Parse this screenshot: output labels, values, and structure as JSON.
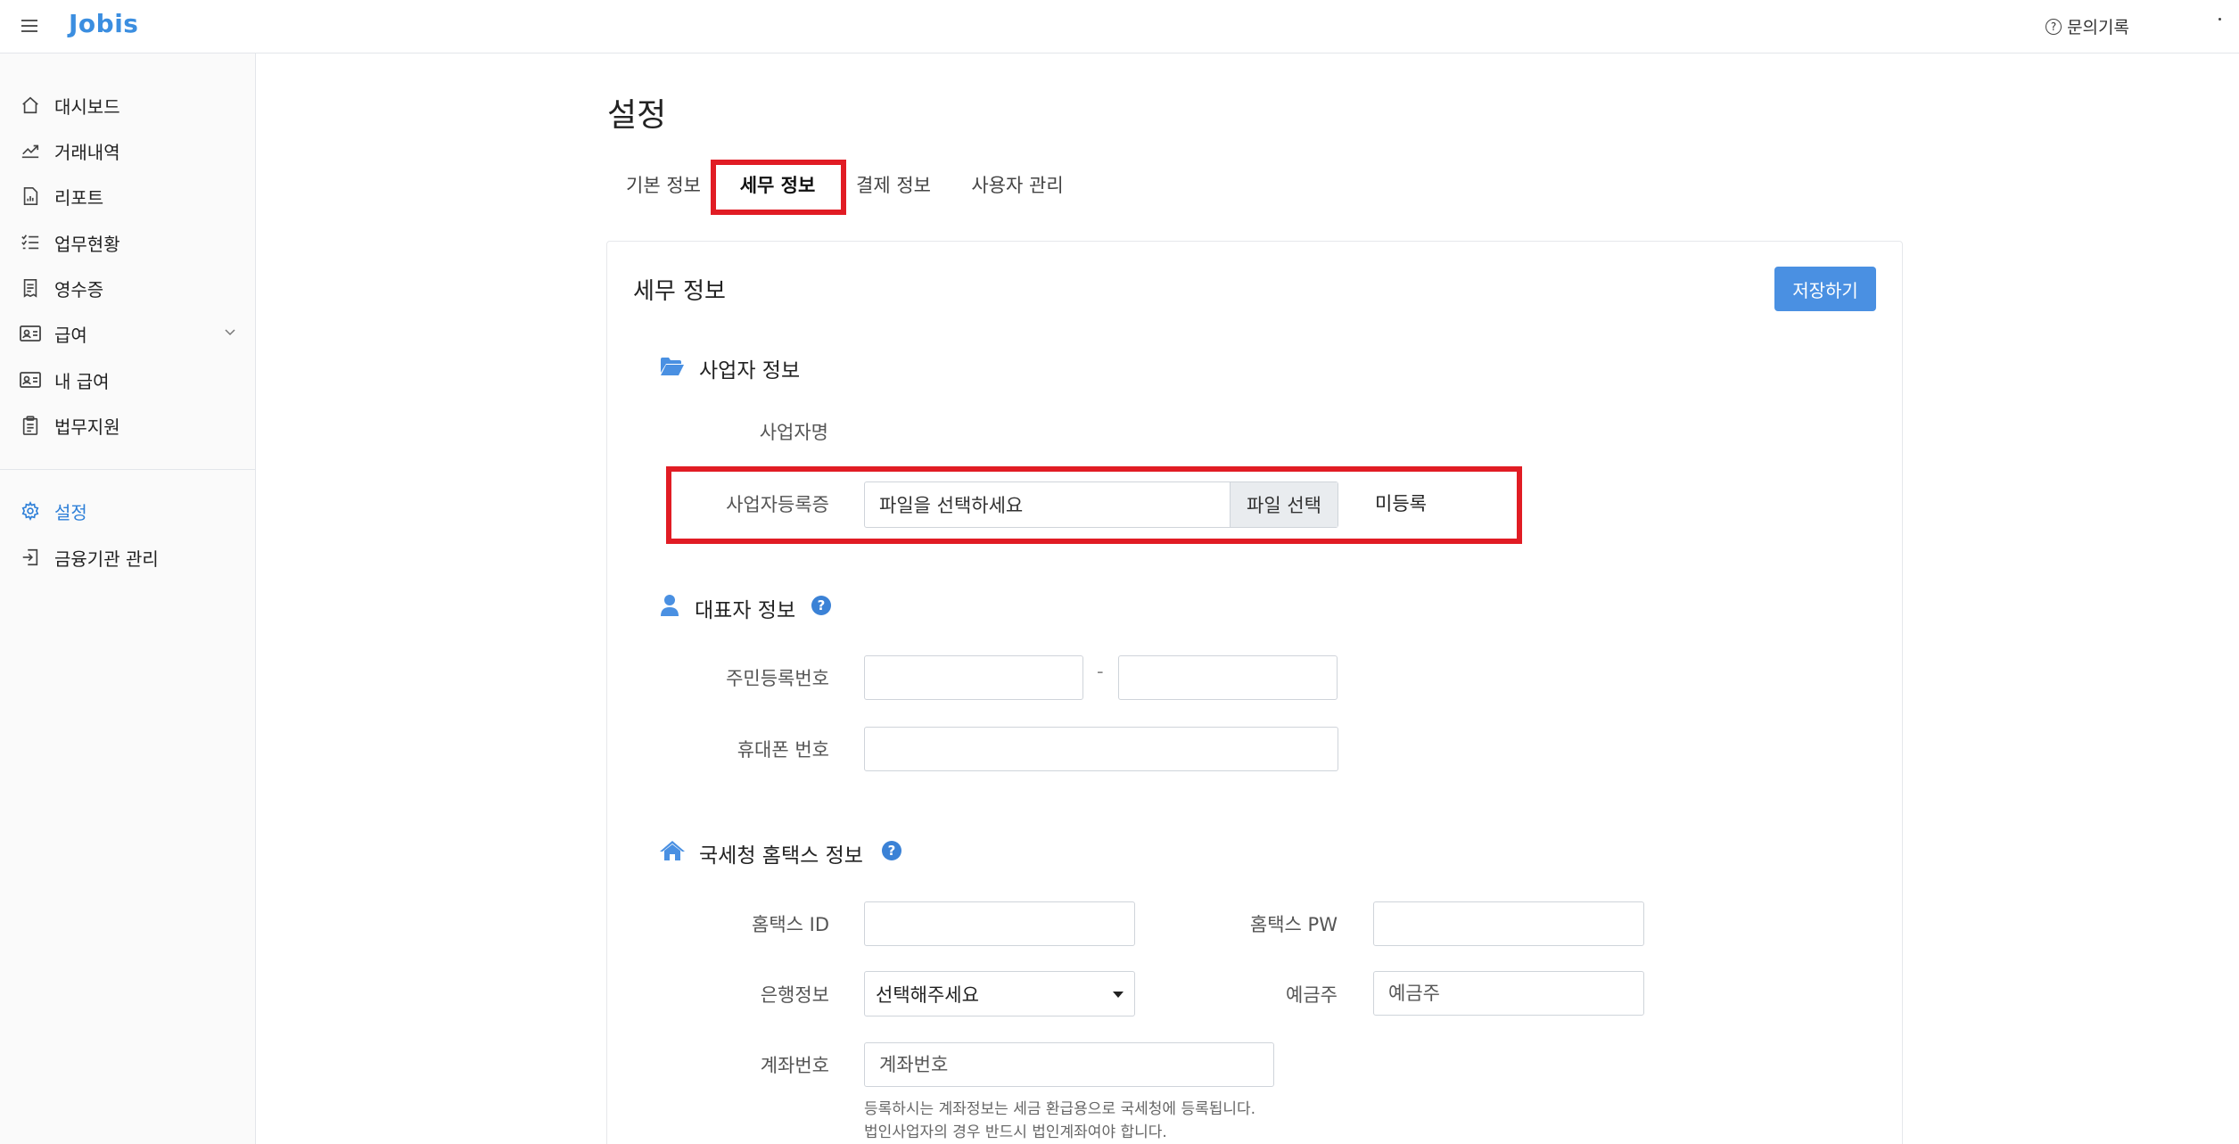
{
  "app": {
    "logo": "Jobis",
    "inquiry_label": "문의기록"
  },
  "sidebar": {
    "items": [
      {
        "label": "대시보드",
        "icon": "home-icon"
      },
      {
        "label": "거래내역",
        "icon": "chart-line-icon"
      },
      {
        "label": "리포트",
        "icon": "report-icon"
      },
      {
        "label": "업무현황",
        "icon": "checklist-icon"
      },
      {
        "label": "영수증",
        "icon": "receipt-icon"
      },
      {
        "label": "급여",
        "icon": "id-card-icon"
      },
      {
        "label": "내 급여",
        "icon": "id-card-icon"
      },
      {
        "label": "법무지원",
        "icon": "clipboard-icon"
      },
      {
        "label": "설정",
        "icon": "gear-icon"
      },
      {
        "label": "금융기관 관리",
        "icon": "sign-in-icon"
      }
    ],
    "active": "설정"
  },
  "page": {
    "title": "설정"
  },
  "tabs": [
    {
      "label": "기본 정보"
    },
    {
      "label": "세무 정보"
    },
    {
      "label": "결제 정보"
    },
    {
      "label": "사용자 관리"
    }
  ],
  "card": {
    "title": "세무 정보",
    "save_label": "저장하기"
  },
  "business": {
    "section_title": "사업자 정보",
    "name_label": "사업자명",
    "cert_label": "사업자등록증",
    "file_placeholder": "파일을 선택하세요",
    "file_button": "파일 선택",
    "status": "미등록"
  },
  "rep": {
    "section_title": "대표자 정보",
    "help": "?",
    "rrn_label": "주민등록번호",
    "rrn_dash": "-",
    "phone_label": "휴대폰 번호"
  },
  "hometax": {
    "section_title": "국세청 홈택스 정보",
    "help": "?",
    "id_label": "홈택스 ID",
    "pw_label": "홈택스 PW",
    "bank_label": "은행정보",
    "bank_selected": "선택해주세요",
    "holder_label": "예금주",
    "holder_placeholder": "예금주",
    "account_label": "계좌번호",
    "account_placeholder": "계좌번호",
    "note1": "등록하시는 계좌정보는 세금 환급용으로 국세청에 등록됩니다.",
    "note2": "법인사업자의 경우 반드시 법인계좌여야 합니다."
  },
  "colors": {
    "brand": "#3b8ee0",
    "highlight": "#e11c24",
    "button": "#4a90e2"
  }
}
